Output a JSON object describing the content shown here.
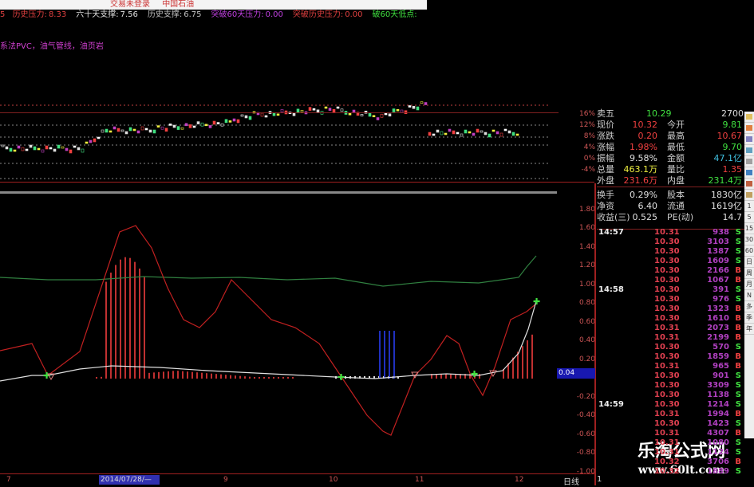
{
  "titlebar": {
    "login": "交易未登录",
    "stock": "中国石油"
  },
  "info": [
    {
      "label": "历史压力:",
      "value": "8.33",
      "color": "#e04040"
    },
    {
      "label": "六十天支撑:",
      "value": "7.56",
      "color": "#e0e0e0"
    },
    {
      "label": "历史支撑:",
      "value": "6.75",
      "color": "#c0c0c0"
    },
    {
      "label": "突破60天压力:",
      "value": "0.00",
      "color": "#c040e0"
    },
    {
      "label": "突破历史压力:",
      "value": "0.00",
      "color": "#e04040"
    },
    {
      "label": "破60天低点:",
      "value": "",
      "color": "#40e040"
    }
  ],
  "info_prefix": "5",
  "concepts": "系法PVC，油气管线，油页岩",
  "upper_axis": [
    "16%",
    "12%",
    "8%",
    "4%",
    "0%",
    "-4%"
  ],
  "lower_axis": [
    "1.80",
    "1.60",
    "1.40",
    "1.20",
    "1.00",
    "0.80",
    "0.60",
    "0.40",
    "0.20",
    "-0.20",
    "-0.40",
    "-0.60",
    "-0.80",
    "-1.00"
  ],
  "current_value": "0.04",
  "quote": {
    "sell5": {
      "label": "卖五",
      "price": "10.29",
      "vol": "2700"
    },
    "rows": [
      {
        "l1": "现价",
        "v1": "10.32",
        "c1": "#f04040",
        "l2": "今开",
        "v2": "9.81",
        "c2": "#40e040"
      },
      {
        "l1": "涨跌",
        "v1": "0.20",
        "c1": "#f04040",
        "l2": "最高",
        "v2": "10.67",
        "c2": "#f04040"
      },
      {
        "l1": "涨幅",
        "v1": "1.98%",
        "c1": "#f04040",
        "l2": "最低",
        "v2": "9.70",
        "c2": "#40e040"
      },
      {
        "l1": "振幅",
        "v1": "9.58%",
        "c1": "#e0e0e0",
        "l2": "金额",
        "v2": "47.1亿",
        "c2": "#40c0e0"
      },
      {
        "l1": "总量",
        "v1": "463.1万",
        "c1": "#f0f040",
        "l2": "量比",
        "v2": "1.35",
        "c2": "#f04040"
      },
      {
        "l1": "外盘",
        "v1": "231.6万",
        "c1": "#f04040",
        "l2": "内盘",
        "v2": "231.4万",
        "c2": "#40e040"
      },
      {
        "l1": "换手",
        "v1": "0.29%",
        "c1": "#e0e0e0",
        "l2": "股本",
        "v2": "1830亿",
        "c2": "#e0e0e0"
      },
      {
        "l1": "净资",
        "v1": "6.40",
        "c1": "#e0e0e0",
        "l2": "流通",
        "v2": "1619亿",
        "c2": "#e0e0e0"
      },
      {
        "l1": "收益(三)",
        "v1": "0.525",
        "c1": "#e0e0e0",
        "l2": "PE(动)",
        "v2": "14.7",
        "c2": "#e0e0e0"
      }
    ]
  },
  "trades": [
    {
      "t": "14:57",
      "p": "10.31",
      "v": "938",
      "s": "S"
    },
    {
      "t": "",
      "p": "10.30",
      "v": "3103",
      "s": "S"
    },
    {
      "t": "",
      "p": "10.30",
      "v": "1387",
      "s": "S"
    },
    {
      "t": "",
      "p": "10.30",
      "v": "1609",
      "s": "S"
    },
    {
      "t": "",
      "p": "10.30",
      "v": "2166",
      "s": "B"
    },
    {
      "t": "",
      "p": "10.30",
      "v": "1067",
      "s": "B"
    },
    {
      "t": "14:58",
      "p": "10.30",
      "v": "391",
      "s": "S"
    },
    {
      "t": "",
      "p": "10.30",
      "v": "976",
      "s": "S"
    },
    {
      "t": "",
      "p": "10.30",
      "v": "1323",
      "s": "B"
    },
    {
      "t": "",
      "p": "10.30",
      "v": "1610",
      "s": "B"
    },
    {
      "t": "",
      "p": "10.31",
      "v": "2073",
      "s": "B"
    },
    {
      "t": "",
      "p": "10.31",
      "v": "2199",
      "s": "B"
    },
    {
      "t": "",
      "p": "10.30",
      "v": "570",
      "s": "S"
    },
    {
      "t": "",
      "p": "10.30",
      "v": "1859",
      "s": "B"
    },
    {
      "t": "",
      "p": "10.31",
      "v": "965",
      "s": "B"
    },
    {
      "t": "",
      "p": "10.30",
      "v": "901",
      "s": "S"
    },
    {
      "t": "",
      "p": "10.30",
      "v": "3309",
      "s": "S"
    },
    {
      "t": "",
      "p": "10.30",
      "v": "1138",
      "s": "S"
    },
    {
      "t": "14:59",
      "p": "10.30",
      "v": "1214",
      "s": "S"
    },
    {
      "t": "",
      "p": "10.31",
      "v": "1994",
      "s": "B"
    },
    {
      "t": "",
      "p": "10.30",
      "v": "1423",
      "s": "S"
    },
    {
      "t": "",
      "p": "10.31",
      "v": "4307",
      "s": "B"
    },
    {
      "t": "",
      "p": "10.31",
      "v": "1080",
      "s": "S"
    },
    {
      "t": "",
      "p": "10.31",
      "v": "1124",
      "s": "S"
    },
    {
      "t": "",
      "p": "10.32",
      "v": "3706",
      "s": "B"
    },
    {
      "t": "",
      "p": "10.32",
      "v": "1889",
      "s": "S"
    }
  ],
  "side_periods": [
    "",
    "",
    "",
    "",
    "",
    "",
    "",
    "",
    "1",
    "5",
    "15",
    "30",
    "60",
    "日",
    "周",
    "月",
    "N",
    "多",
    "季",
    "年"
  ],
  "xaxis": {
    "labels": [
      "7",
      "9",
      "10",
      "11",
      "12"
    ],
    "cursor_date": "2014/07/28/—",
    "period": "日线",
    "page": "1"
  },
  "watermark": {
    "name": "乐淘公式网",
    "url": "www.60lt.com"
  },
  "colors": {
    "up": "#f04040",
    "down": "#40e040",
    "sell": "#40e040",
    "buy": "#f04040",
    "vol": "#c040e0",
    "accent": "#2020a0"
  }
}
